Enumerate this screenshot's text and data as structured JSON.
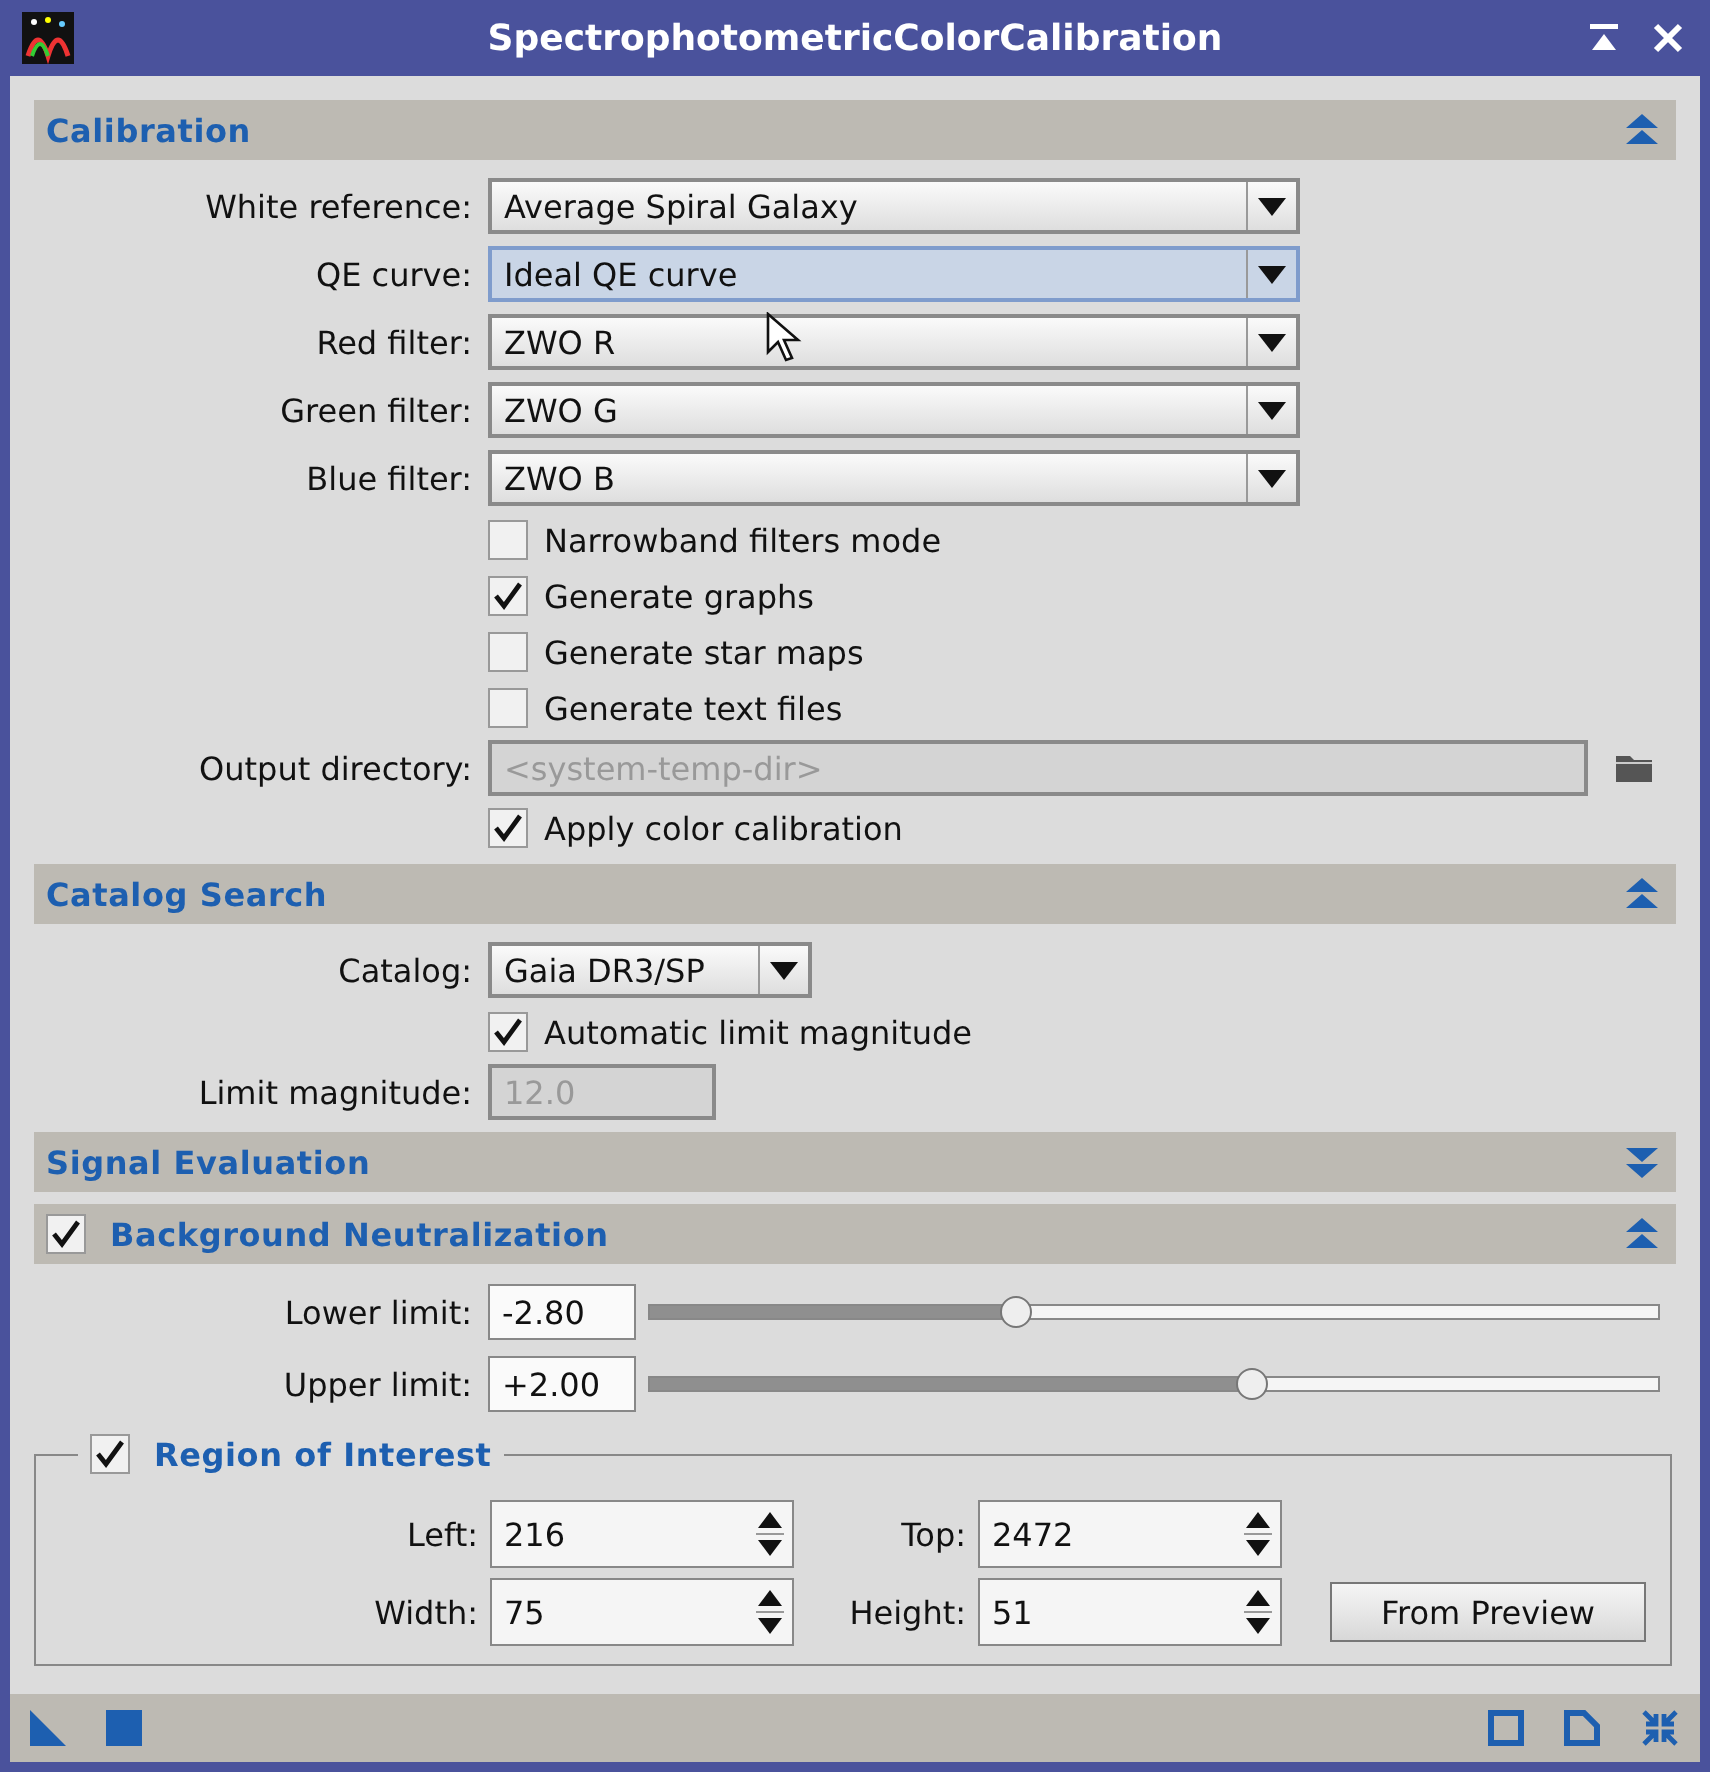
{
  "window": {
    "title": "SpectrophotometricColorCalibration"
  },
  "sections": [
    {
      "title": "Calibration",
      "expanded": true,
      "rows": [
        {
          "kind": "combo",
          "label": "White reference:",
          "value": "Average Spiral Galaxy",
          "focused": false
        },
        {
          "kind": "combo",
          "label": "QE curve:",
          "value": "Ideal QE curve",
          "focused": true
        },
        {
          "kind": "combo",
          "label": "Red filter:",
          "value": "ZWO R",
          "focused": false
        },
        {
          "kind": "combo",
          "label": "Green filter:",
          "value": "ZWO G",
          "focused": false
        },
        {
          "kind": "combo",
          "label": "Blue filter:",
          "value": "ZWO B",
          "focused": false
        },
        {
          "kind": "checkbox",
          "label": "Narrowband filters mode",
          "checked": false
        },
        {
          "kind": "checkbox",
          "label": "Generate graphs",
          "checked": true
        },
        {
          "kind": "checkbox",
          "label": "Generate star maps",
          "checked": false
        },
        {
          "kind": "checkbox",
          "label": "Generate text files",
          "checked": false
        },
        {
          "kind": "directory",
          "label": "Output directory:",
          "value": "<system-temp-dir>",
          "disabled": true
        },
        {
          "kind": "checkbox",
          "label": "Apply color calibration",
          "checked": true
        }
      ]
    },
    {
      "title": "Catalog Search",
      "expanded": true,
      "rows": [
        {
          "kind": "short_combo",
          "label": "Catalog:",
          "value": "Gaia DR3/SP",
          "focused": false
        },
        {
          "kind": "checkbox",
          "label": "Automatic limit magnitude",
          "checked": true
        },
        {
          "kind": "number",
          "label": "Limit magnitude:",
          "value": "12.0",
          "disabled": true
        }
      ]
    },
    {
      "title": "Signal Evaluation",
      "expanded": false
    },
    {
      "title": "Background Neutralization",
      "expanded": true,
      "checked": true,
      "rows": [
        {
          "kind": "slider",
          "label": "Lower limit:",
          "value": "-2.80",
          "level": 0.364
        },
        {
          "kind": "slider",
          "label": "Upper limit:",
          "value": "+2.00",
          "level": 0.597
        }
      ],
      "group": {
        "title": "Region of Interest",
        "checked": true,
        "fields": [
          {
            "label": "Left:",
            "value": "216"
          },
          {
            "label": "Top:",
            "value": "2472"
          },
          {
            "label": "Width:",
            "value": "75"
          },
          {
            "label": "Height:",
            "value": "51"
          }
        ],
        "button": "From Preview"
      }
    }
  ]
}
